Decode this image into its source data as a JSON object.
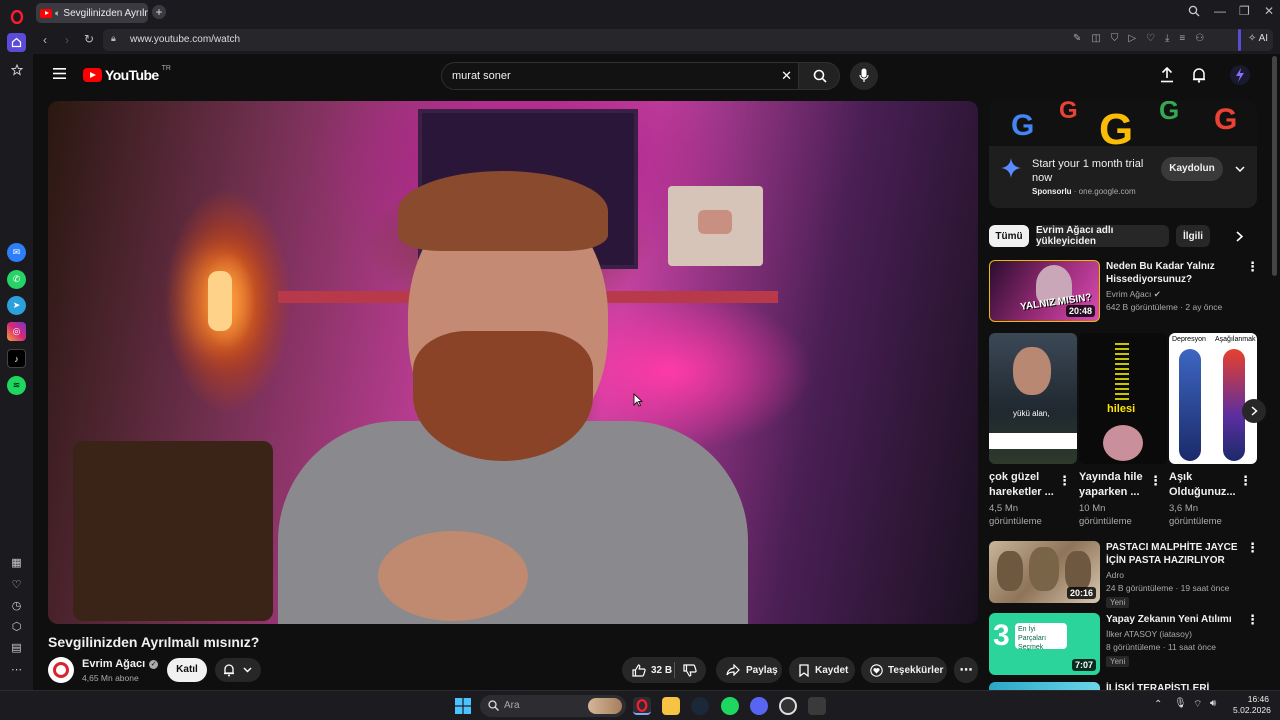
{
  "browser": {
    "tab_title": "Sevgilinizden Ayrılmalı",
    "url": "www.youtube.com/watch",
    "ai_label": "AI"
  },
  "youtube": {
    "logo_text": "YouTube",
    "region": "TR",
    "search_value": "murat soner"
  },
  "video": {
    "title": "Sevgilinizden Ayrılmalı mısınız?",
    "channel_name": "Evrim Ağacı",
    "subscribers": "4,65 Mn abone",
    "join_label": "Katıl",
    "likes": "32 B",
    "share_label": "Paylaş",
    "save_label": "Kaydet",
    "thanks_label": "Teşekkürler"
  },
  "ad": {
    "headline": "Start your 1 month trial now",
    "sponsored": "Sponsorlu",
    "domain": "one.google.com",
    "cta": "Kaydolun"
  },
  "filters": [
    "Tümü",
    "Evrim Ağacı adlı yükleyiciden",
    "İlgili"
  ],
  "recommendations": [
    {
      "title": "Neden Bu Kadar Yalnız Hissediyorsunuz?",
      "channel": "Evrim Ağacı",
      "stats": "642 B görüntüleme · 2 ay önce",
      "duration": "20:48",
      "thumb_text": "YALNIZ MISIN?"
    },
    {
      "title": "PASTACI MALPHİTE JAYCE İÇİN PASTA HAZIRLIYOR",
      "channel": "Adro",
      "stats": "24 B görüntüleme · 19 saat önce",
      "duration": "20:16",
      "badge": "Yeni"
    },
    {
      "title": "Yapay Zekanın Yeni Atılımı",
      "channel": "İlker ATASOY (iatasoy)",
      "stats": "8 görüntüleme · 11 saat önce",
      "duration": "7:07",
      "badge": "Yeni",
      "thumb_text": "En İyi Parçaları Seçmek"
    },
    {
      "title": "İLİŞKİ TERAPİSTLERİ",
      "channel": "",
      "stats": ""
    }
  ],
  "shorts": [
    {
      "title": "çok güzel hareketler ...",
      "views": "4,5 Mn görüntüleme",
      "thumb_text": "yükü alan,"
    },
    {
      "title": "Yayında hile yaparken ...",
      "views": "10 Mn görüntüleme",
      "thumb_text": "hilesi"
    },
    {
      "title": "Aşık Olduğunuz...",
      "views": "3,6 Mn görüntüleme",
      "thumb_text_left": "Depresyon",
      "thumb_text_right": "Aşağılanmak"
    }
  ],
  "taskbar": {
    "search_placeholder": "Ara",
    "time": "16:46",
    "date": "5.02.2026"
  },
  "colors": {
    "yt_red": "#ff0000",
    "background": "#0f0f0f",
    "chip_bg": "#272727",
    "opera_red": "#ff1b2d"
  }
}
